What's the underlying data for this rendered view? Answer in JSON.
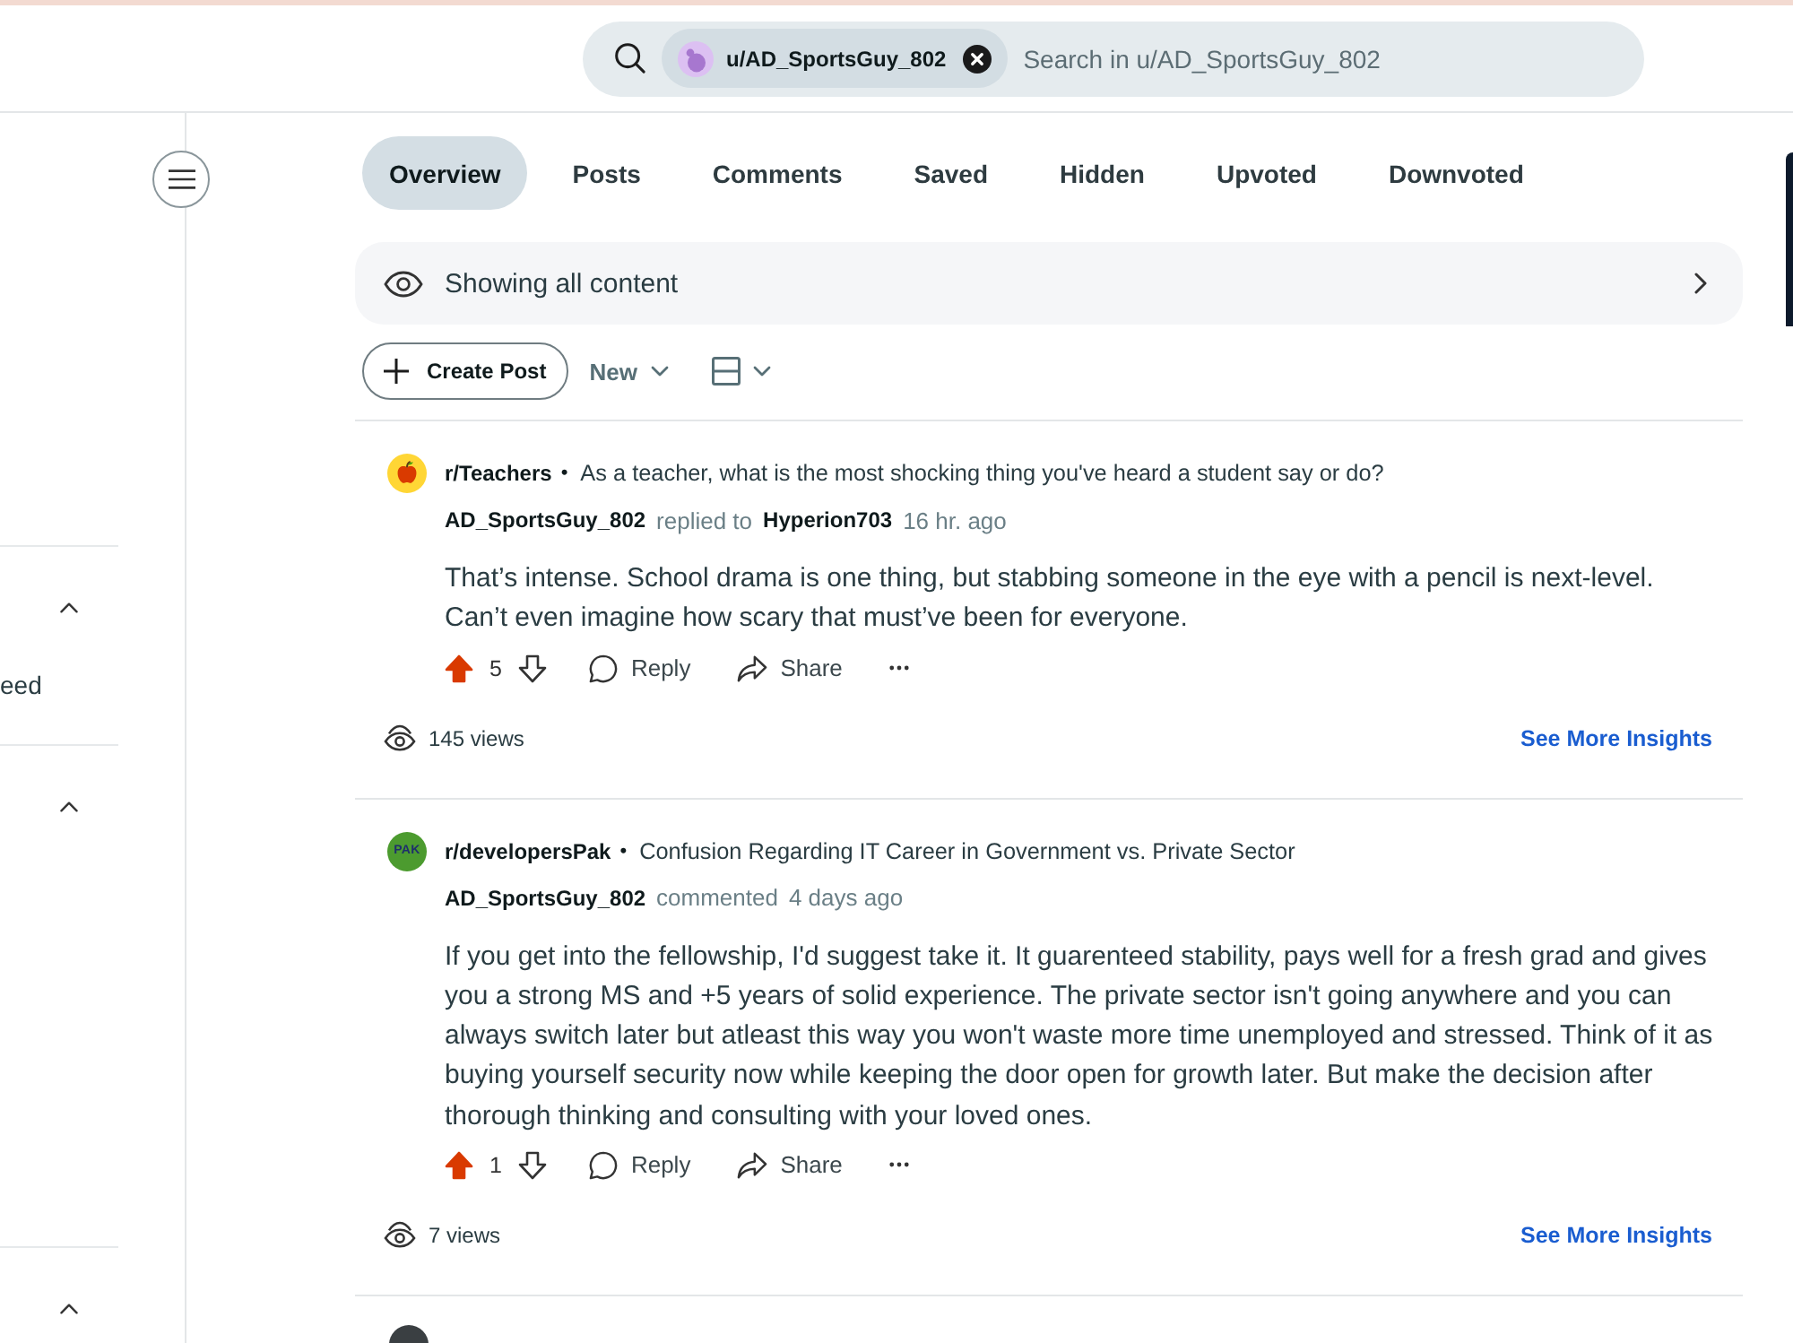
{
  "search": {
    "scope": "u/AD_SportsGuy_802",
    "placeholder": "Search in u/AD_SportsGuy_802"
  },
  "sidebar": {
    "sections": [
      {
        "expanded": true,
        "items": [
          {
            "label": "eed"
          }
        ]
      },
      {
        "expanded": true
      },
      {
        "expanded": true
      }
    ]
  },
  "tabs": [
    {
      "label": "Overview",
      "selected": true
    },
    {
      "label": "Posts",
      "selected": false
    },
    {
      "label": "Comments",
      "selected": false
    },
    {
      "label": "Saved",
      "selected": false
    },
    {
      "label": "Hidden",
      "selected": false
    },
    {
      "label": "Upvoted",
      "selected": false
    },
    {
      "label": "Downvoted",
      "selected": false
    }
  ],
  "filter": {
    "label": "Showing all content"
  },
  "toolbar": {
    "create_label": "Create Post",
    "sort": "New"
  },
  "comments": [
    {
      "avatar": {
        "kind": "apple"
      },
      "community": "r/Teachers",
      "separator": "•",
      "post_title": "As a teacher, what is the most shocking thing you've heard a student say or do?",
      "author": "AD_SportsGuy_802",
      "action": "replied to",
      "target": "Hyperion703",
      "time": "16 hr. ago",
      "body": "That’s intense. School drama is one thing, but stabbing someone in the eye with a pencil is next-level. Can’t even imagine how scary that must’ve been for everyone.",
      "upvoted": true,
      "score": "5",
      "reply": "Reply",
      "share": "Share",
      "views": "145 views",
      "insights": "See More Insights"
    },
    {
      "avatar": {
        "kind": "badge",
        "text": "PAK"
      },
      "community": "r/developersPak",
      "separator": "•",
      "post_title": "Confusion Regarding IT Career in Government vs. Private Sector",
      "author": "AD_SportsGuy_802",
      "action": "commented",
      "time": "4 days ago",
      "body": "If you get into the fellowship, I'd suggest take it. It guarenteed stability, pays well for a fresh grad and gives you a strong MS and +5 years of solid experience. The private sector isn't going anywhere and you can always switch later but atleast this way you won't waste more time unemployed and stressed. Think of it as buying yourself security now while keeping the door open for growth later. But make the decision after thorough thinking and consulting with your loved ones.",
      "upvoted": true,
      "score": "1",
      "reply": "Reply",
      "share": "Share",
      "views": "7 views",
      "insights": "See More Insights"
    }
  ]
}
